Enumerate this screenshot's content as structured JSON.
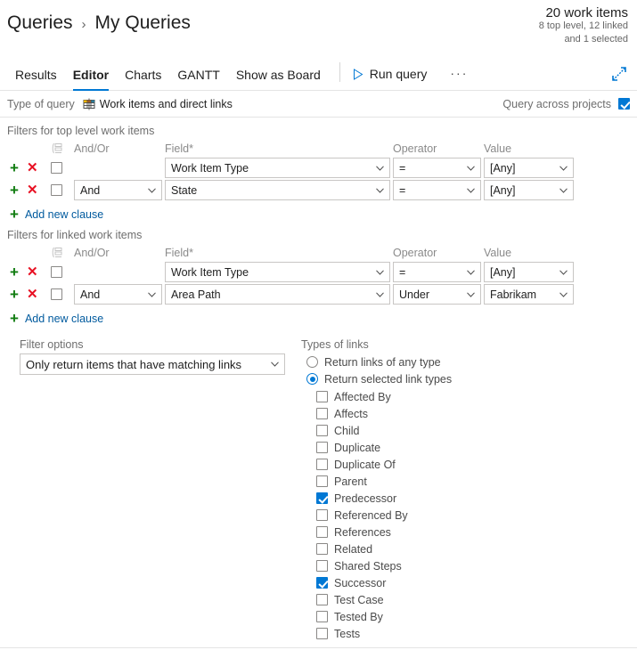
{
  "header": {
    "breadcrumb": [
      "Queries",
      "My Queries"
    ],
    "separator": "›",
    "counts": {
      "total": "20 work items",
      "line1": "8 top level, 12 linked",
      "line2": "and 1 selected"
    }
  },
  "tabs": [
    {
      "label": "Results",
      "active": false
    },
    {
      "label": "Editor",
      "active": true
    },
    {
      "label": "Charts",
      "active": false
    },
    {
      "label": "GANTT",
      "active": false
    },
    {
      "label": "Show as Board",
      "active": false
    }
  ],
  "toolbar": {
    "run_query_label": "Run query",
    "run_query_icon": "play-icon",
    "more_label": "···",
    "expand_icon": "full-screen-icon"
  },
  "query_type": {
    "label": "Type of query",
    "icon": "work-items-direct-links-icon",
    "value": "Work items and direct links",
    "across_projects_label": "Query across projects",
    "across_projects_checked": true
  },
  "top_level": {
    "title": "Filters for top level work items",
    "columns": [
      "And/Or",
      "Field*",
      "Operator",
      "Value"
    ],
    "group_icon": "group-clauses-icon",
    "rows": [
      {
        "add": "+",
        "delete": "✕",
        "grouped": false,
        "andor": "",
        "field": "Work Item Type",
        "operator": "=",
        "value": "[Any]"
      },
      {
        "add": "+",
        "delete": "✕",
        "grouped": false,
        "andor": "And",
        "field": "State",
        "operator": "=",
        "value": "[Any]"
      }
    ],
    "add_clause_label": "Add new clause",
    "add_clause_icon": "+"
  },
  "linked": {
    "title": "Filters for linked work items",
    "columns": [
      "And/Or",
      "Field*",
      "Operator",
      "Value"
    ],
    "group_icon": "group-clauses-icon",
    "rows": [
      {
        "add": "+",
        "delete": "✕",
        "grouped": false,
        "andor": "",
        "field": "Work Item Type",
        "operator": "=",
        "value": "[Any]"
      },
      {
        "add": "+",
        "delete": "✕",
        "grouped": false,
        "andor": "And",
        "field": "Area Path",
        "operator": "Under",
        "value": "Fabrikam"
      }
    ],
    "add_clause_label": "Add new clause",
    "add_clause_icon": "+"
  },
  "filter_options": {
    "label": "Filter options",
    "value": "Only return items that have matching links"
  },
  "link_types": {
    "title": "Types of links",
    "radios": [
      {
        "label": "Return links of any type",
        "selected": false
      },
      {
        "label": "Return selected link types",
        "selected": true
      }
    ],
    "items": [
      {
        "label": "Affected By",
        "checked": false
      },
      {
        "label": "Affects",
        "checked": false
      },
      {
        "label": "Child",
        "checked": false
      },
      {
        "label": "Duplicate",
        "checked": false
      },
      {
        "label": "Duplicate Of",
        "checked": false
      },
      {
        "label": "Parent",
        "checked": false
      },
      {
        "label": "Predecessor",
        "checked": true
      },
      {
        "label": "Referenced By",
        "checked": false
      },
      {
        "label": "References",
        "checked": false
      },
      {
        "label": "Related",
        "checked": false
      },
      {
        "label": "Shared Steps",
        "checked": false
      },
      {
        "label": "Successor",
        "checked": true
      },
      {
        "label": "Test Case",
        "checked": false
      },
      {
        "label": "Tested By",
        "checked": false
      },
      {
        "label": "Tests",
        "checked": false
      }
    ]
  },
  "colors": {
    "accent": "#0078d4",
    "add": "#107c10",
    "delete": "#e81123",
    "link": "#005a9e"
  }
}
